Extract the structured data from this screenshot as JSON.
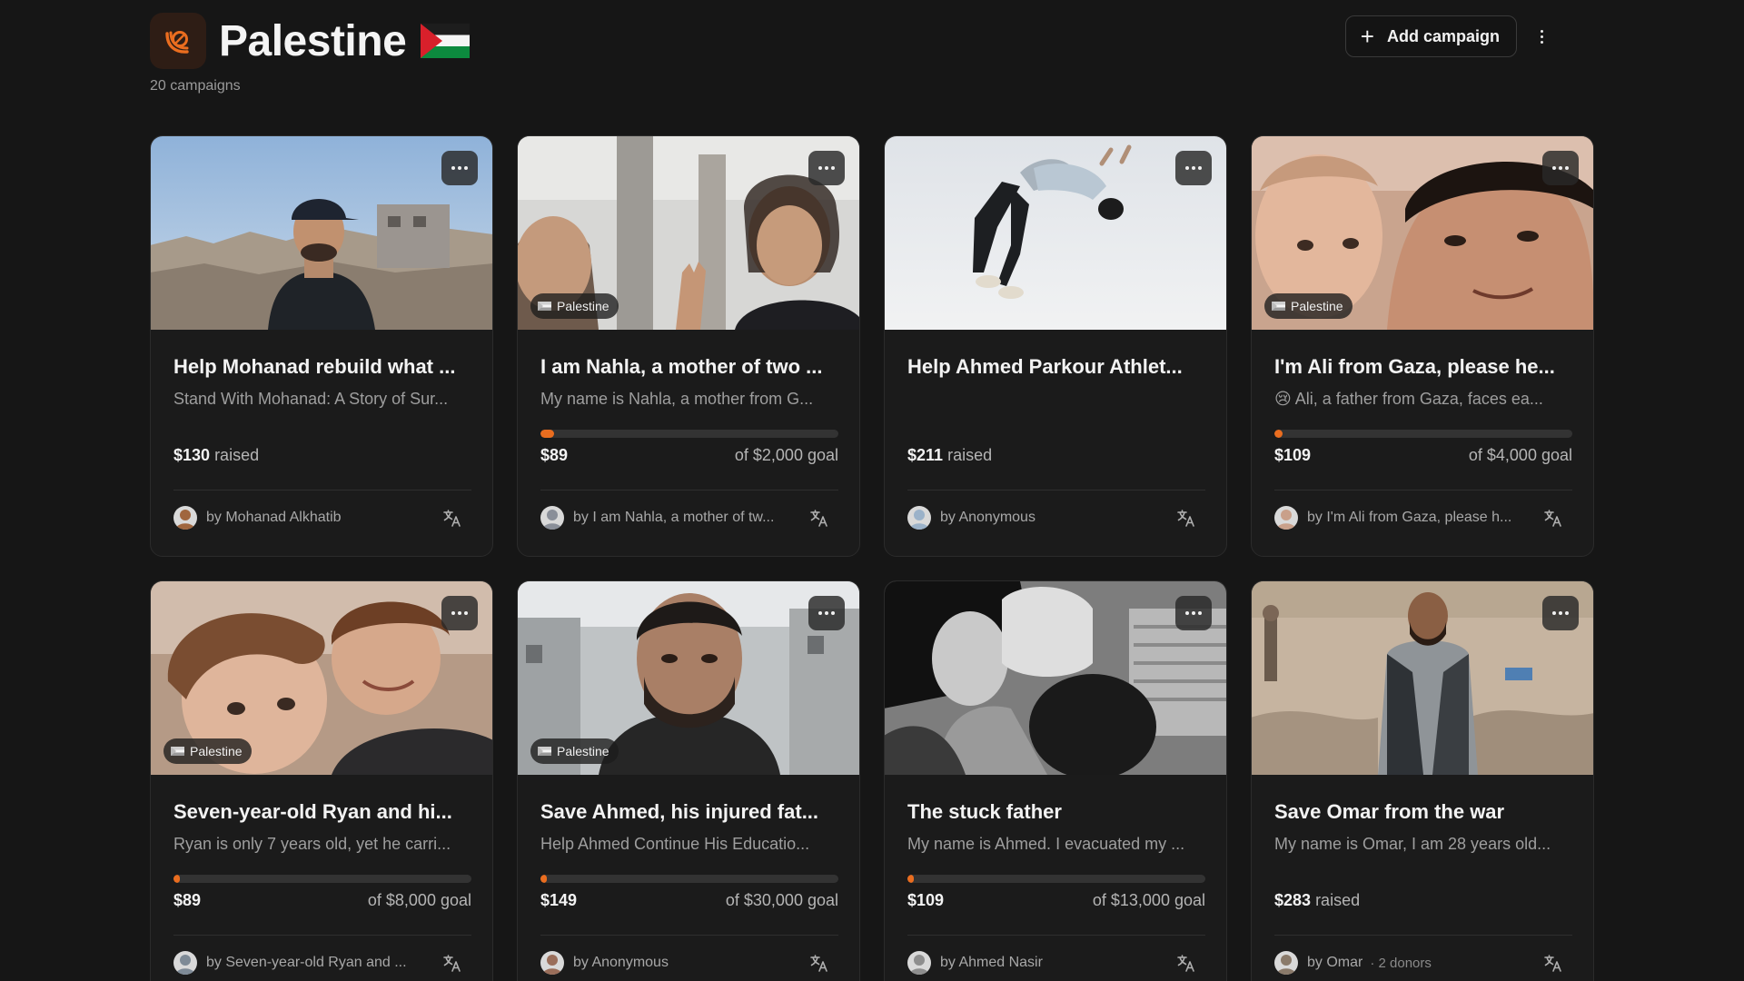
{
  "header": {
    "title": "Palestine",
    "campaign_count": "20 campaigns",
    "add_button_label": "Add campaign",
    "accent": "#ea6d1f"
  },
  "campaigns": [
    {
      "title": "Help Mohanad rebuild what ...",
      "subtitle": "Stand With Mohanad: A Story of Sur...",
      "tag": "",
      "amount": "$130",
      "raised_label": "raised",
      "goal": "",
      "progress": null,
      "by": "by Mohanad Alkhatib",
      "donors": "",
      "photo": "rubble-man-cap"
    },
    {
      "title": "I am Nahla, a mother of two ...",
      "subtitle": "My name is Nahla, a mother from G...",
      "tag": "Palestine",
      "amount": "$89",
      "raised_label": "",
      "goal": "of $2,000 goal",
      "progress": 0.045,
      "by": "by I am Nahla, a mother of tw...",
      "donors": "",
      "photo": "two-children-peace"
    },
    {
      "title": "Help Ahmed Parkour Athlet...",
      "subtitle": "",
      "tag": "",
      "amount": "$211",
      "raised_label": "raised",
      "goal": "",
      "progress": null,
      "by": "by Anonymous",
      "donors": "",
      "photo": "parkour-flip"
    },
    {
      "title": "I'm Ali from Gaza, please he...",
      "subtitle": "😢 Ali, a father from Gaza, faces ea...",
      "tag": "Palestine",
      "amount": "$109",
      "raised_label": "",
      "goal": "of $4,000 goal",
      "progress": 0.027,
      "by": "by I'm Ali from Gaza, please h...",
      "donors": "",
      "photo": "father-child-selfie"
    },
    {
      "title": "Seven-year-old Ryan and hi...",
      "subtitle": "Ryan is only 7 years old, yet he carri...",
      "tag": "Palestine",
      "amount": "$89",
      "raised_label": "",
      "goal": "of $8,000 goal",
      "progress": 0.011,
      "by": "by Seven-year-old Ryan and ...",
      "donors": "",
      "photo": "two-kids-hug"
    },
    {
      "title": "Save Ahmed, his injured fat...",
      "subtitle": "Help Ahmed Continue His Educatio...",
      "tag": "Palestine",
      "amount": "$149",
      "raised_label": "",
      "goal": "of $30,000 goal",
      "progress": 0.005,
      "by": "by Anonymous",
      "donors": "",
      "photo": "man-street-selfie"
    },
    {
      "title": "The stuck father",
      "subtitle": "My name is Ahmed. I evacuated my ...",
      "tag": "",
      "amount": "$109",
      "raised_label": "",
      "goal": "of $13,000 goal",
      "progress": 0.008,
      "by": "by Ahmed Nasir",
      "donors": "",
      "photo": "bw-father-children"
    },
    {
      "title": "Save Omar from the war",
      "subtitle": "My name is Omar, I am 28 years old...",
      "tag": "",
      "amount": "$283",
      "raised_label": "raised",
      "goal": "",
      "progress": null,
      "by": "by Omar",
      "donors": "· 2 donors",
      "photo": "man-jacket-rubble"
    }
  ]
}
